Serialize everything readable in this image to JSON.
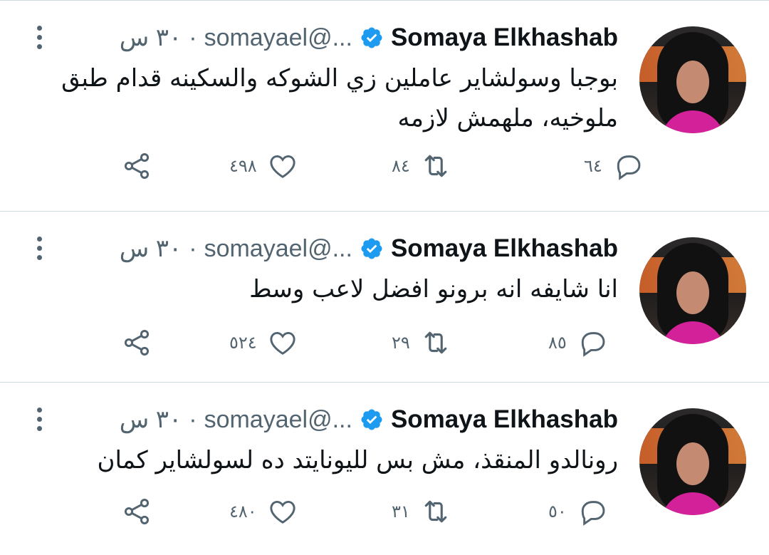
{
  "colors": {
    "accent": "#1d9bf0",
    "muted": "#536471",
    "text": "#0f1419",
    "divider": "#cfd9de"
  },
  "tweets": [
    {
      "name": "Somaya Elkhashab",
      "handle": "...@somayael",
      "time": "٣٠ س",
      "text": "بوجبا وسولشاير عاملين زي الشوكه والسكينه قدام طبق ملوخيه، ملهمش لازمه",
      "replies": "٦٤",
      "retweets": "٨٤",
      "likes": "٤٩٨"
    },
    {
      "name": "Somaya Elkhashab",
      "handle": "...@somayael",
      "time": "٣٠ س",
      "text": "انا شايفه انه برونو افضل لاعب وسط",
      "replies": "٨٥",
      "retweets": "٢٩",
      "likes": "٥٢٤"
    },
    {
      "name": "Somaya Elkhashab",
      "handle": "...@somayael",
      "time": "٣٠ س",
      "text": "رونالدو المنقذ، مش بس لليونايتد ده لسولشاير كمان",
      "replies": "٥٠",
      "retweets": "٣١",
      "likes": "٤٨٠"
    }
  ]
}
